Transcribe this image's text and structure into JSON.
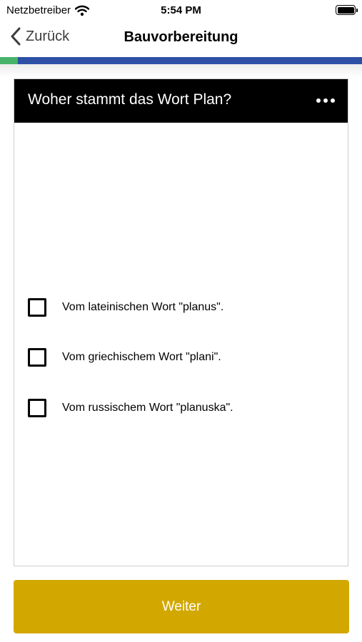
{
  "status_bar": {
    "carrier": "Netzbetreiber",
    "time": "5:54 PM"
  },
  "nav": {
    "back_label": "Zurück",
    "title": "Bauvorbereitung"
  },
  "progress": {
    "fraction": 0.05,
    "fill_color": "#47b36a",
    "track_color": "#2d50a6"
  },
  "question": {
    "text": "Woher stammt das Wort Plan?",
    "answers": [
      {
        "label": "Vom lateinischen Wort \"planus\".",
        "checked": false
      },
      {
        "label": "Vom griechischem Wort \"plani\".",
        "checked": false
      },
      {
        "label": "Vom russischem Wort \"planuska\".",
        "checked": false
      }
    ]
  },
  "next_button": {
    "label": "Weiter",
    "color": "#d2a800"
  }
}
